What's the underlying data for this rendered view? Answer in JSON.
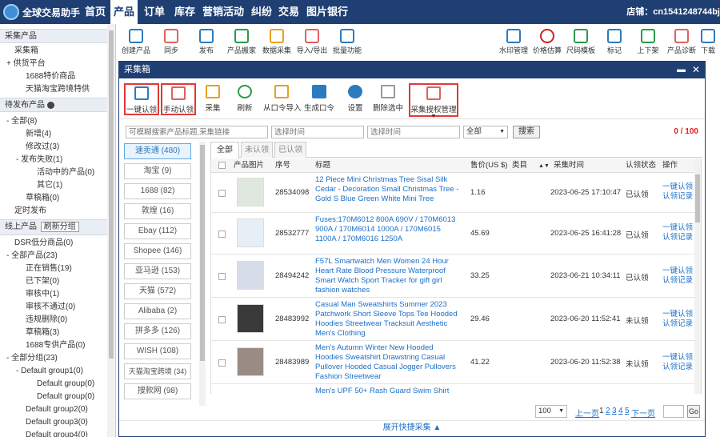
{
  "app": {
    "name": "全球交易助手",
    "store": "店铺：cn1541248744bj"
  },
  "nav": [
    "首页",
    "产品",
    "订单",
    "库存",
    "营销活动",
    "纠纷",
    "交易",
    "图片银行"
  ],
  "nav_active": 1,
  "sidebar": {
    "section1": "采集产品",
    "items1": [
      "采集箱",
      "+ 供货平台",
      "1688特价商品",
      "天猫淘宝跨境特供"
    ],
    "section2": "待发布产品",
    "items2": [
      "- 全部(8)",
      "新增(4)",
      "修改过(3)",
      "- 发布失败(1)",
      "活动中的产品(0)",
      "其它(1)",
      "草稿箱(0)",
      "定时发布"
    ],
    "section3": "线上产品",
    "refresh_btn": "刷新分组",
    "items3": [
      "DSR低分商品(0)",
      "- 全部产品(23)",
      "正在销售(19)",
      "已下架(0)",
      "审核中(1)",
      "审核不通过(0)",
      "违规删除(0)",
      "草稿箱(3)",
      "1688专供产品(0)",
      "- 全部分组(23)",
      "- Default group1(0)",
      "Default group(0)",
      "Default group(0)",
      "Default group2(0)",
      "Default group3(0)",
      "Default group4(0)"
    ]
  },
  "bg_toolbar": [
    "创建产品",
    "同步",
    "发布",
    "产品搬家",
    "数据采集",
    "导入/导出",
    "批量功能",
    "水印管理",
    "价格估算",
    "尺码模板",
    "标记",
    "上下架",
    "产品诊断",
    "下载"
  ],
  "modal": {
    "title": "采集箱",
    "toolbar": [
      "一键认领",
      "手动认领",
      "采集",
      "刷新",
      "从口令导入",
      "生成口令",
      "设置",
      "删除选中",
      "采集授权管理"
    ],
    "search_placeholder": "可模糊搜索产品标题,采集链接",
    "date1_placeholder": "选择时间",
    "date2_placeholder": "选择时间",
    "status_select": "全部",
    "search_btn": "搜索",
    "count": "0 / 100",
    "platforms": [
      "速卖通 (480)",
      "淘宝 (9)",
      "1688 (82)",
      "敦煌 (16)",
      "Ebay (112)",
      "Shopee (146)",
      "亚马逊 (153)",
      "天猫 (572)",
      "Alibaba (2)",
      "拼多多 (126)",
      "WISH (108)",
      "天猫淘宝跨境 (34)",
      "搜款网 (98)"
    ],
    "tabs": [
      "全部",
      "未认领",
      "已认领"
    ],
    "columns": [
      "产品图片",
      "序号",
      "标题",
      "售价(US $)",
      "类目",
      "采集时间",
      "认领状态",
      "操作"
    ],
    "rows": [
      {
        "id": "28534098",
        "title": "12 Piece Mini Christmas Tree Sisal Silk Cedar - Decoration Small Christmas Tree - Gold S Blue Green White Mini Tree",
        "price": "1.16",
        "time": "2023-06-25 17:10:47",
        "status": "已认领",
        "op1": "一键认领",
        "op2": "认领记录"
      },
      {
        "id": "28532777",
        "title": "Fuses:170M6012 800A 690V / 170M6013 900A / 170M6014 1000A / 170M6015 1100A / 170M6016 1250A",
        "price": "45.69",
        "time": "2023-06-25 16:41:28",
        "status": "已认领",
        "op1": "一键认领",
        "op2": "认领记录"
      },
      {
        "id": "28494242",
        "title": "F57L Smartwatch Men Women 24 Hour Heart Rate Blood Pressure Waterproof Smart Watch Sport Tracker for gift girl fashion watches",
        "price": "33.25",
        "time": "2023-06-21 10:34:11",
        "status": "已认领",
        "op1": "一键认领",
        "op2": "认领记录"
      },
      {
        "id": "28483992",
        "title": "Casual Man Sweatshirts Summer 2023 Patchwork Short Sleeve Tops Tee Hooded Hoodies Streetwear Tracksuit Aesthetic Men's Clothing",
        "price": "29.46",
        "time": "2023-06-20 11:52:41",
        "status": "未认领",
        "op1": "一键认领",
        "op2": "认领记录"
      },
      {
        "id": "28483989",
        "title": "Men's Autumn Winter New Hooded Hoodies Sweatshirt Drawstring Casual Pullover Hooded Casual Jogger Pullovers Fashion Streetwear",
        "price": "41.22",
        "time": "2023-06-20 11:52:38",
        "status": "未认领",
        "op1": "一键认领",
        "op2": "认领记录"
      },
      {
        "id": "",
        "title": "Men's UPF 50+ Rash Guard Swim Shirt",
        "price": "",
        "time": "",
        "status": "",
        "op1": "",
        "op2": ""
      }
    ],
    "pager": {
      "size": "100",
      "prev": "上一页",
      "pages": [
        "1",
        "2",
        "3",
        "4",
        "5"
      ],
      "next": "下一页",
      "go": "Go"
    },
    "expand": "展开快捷采集 ▲"
  }
}
